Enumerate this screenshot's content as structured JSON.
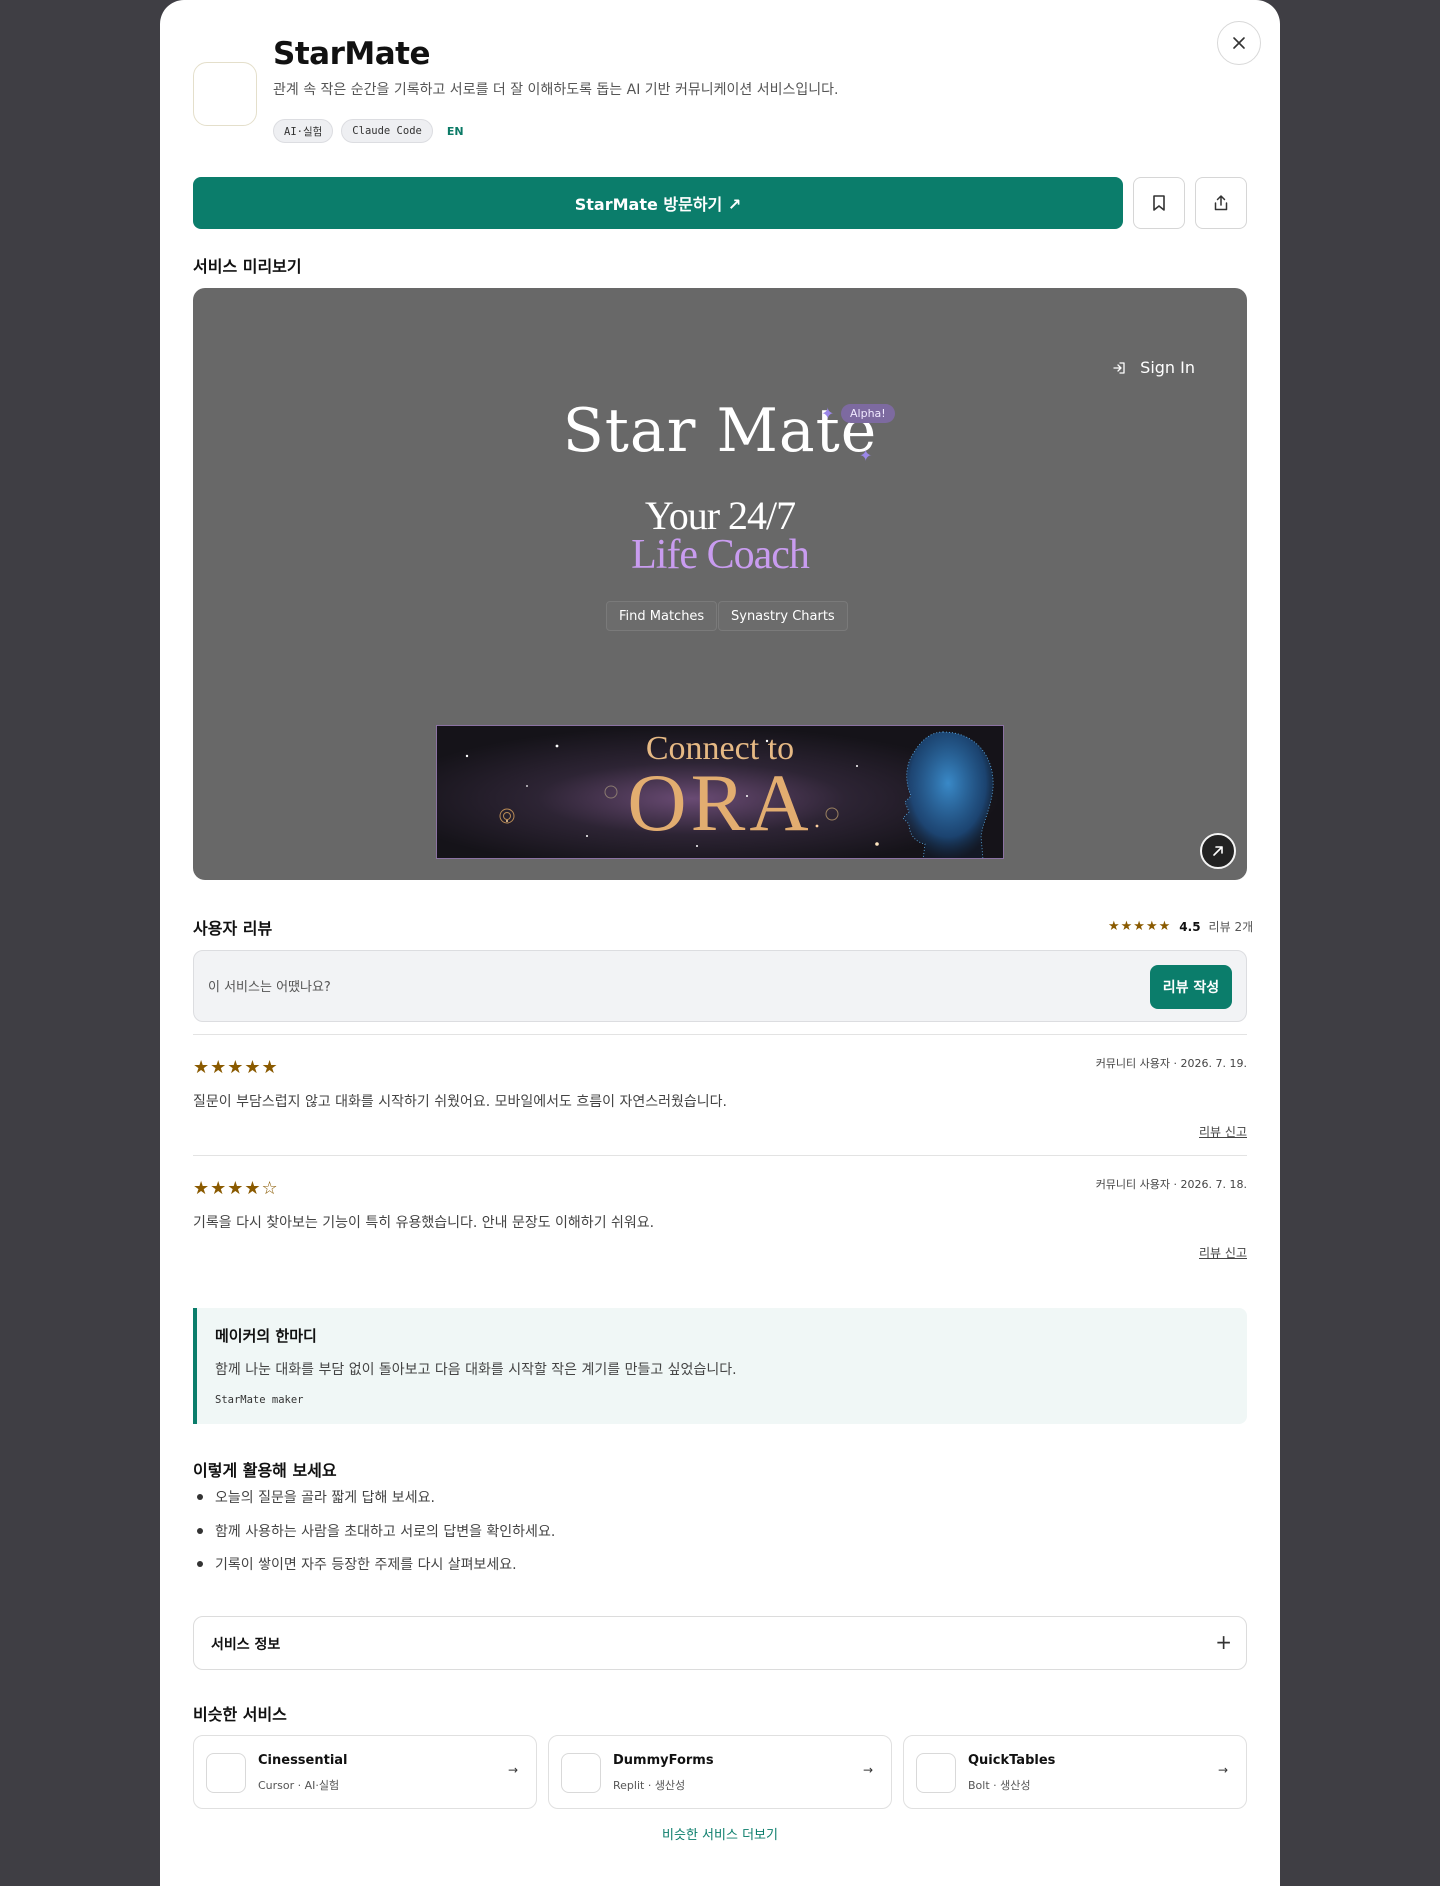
{
  "app": {
    "title": "StarMate",
    "description": "관계 속 작은 순간을 기록하고 서로를 더 잘 이해하도록 돕는 AI 기반 커뮤니케이션 서비스입니다.",
    "tags": [
      "AI·실험",
      "Claude Code"
    ],
    "language": "EN",
    "accent_color": "#0b7d6b"
  },
  "actions": {
    "visit_label": "StarMate 방문하기 ↗",
    "bookmark_icon": "bookmark-icon",
    "share_icon": "share-icon",
    "close_icon": "close-icon"
  },
  "preview": {
    "section_title": "서비스 미리보기",
    "sign_in": "Sign In",
    "brand": "Star Mate",
    "badge": "Alpha!",
    "tagline_line1": "Your 24/7",
    "tagline_line2": "Life Coach",
    "buttons": [
      "Find Matches",
      "Synastry Charts"
    ],
    "banner_line1": "Connect to",
    "banner_line2": "ORA",
    "expand_icon": "arrow-up-right-icon"
  },
  "reviews": {
    "section_title": "사용자 리뷰",
    "summary_stars": "★★★★★",
    "average": "4.5",
    "count_label": "리뷰 2개",
    "input_placeholder": "이 서비스는 어땠나요?",
    "write_button": "리뷰 작성",
    "items": [
      {
        "stars": "★★★★★",
        "meta": "커뮤니티 사용자 · 2026. 7. 19.",
        "text": "질문이 부담스럽지 않고 대화를 시작하기 쉬웠어요. 모바일에서도 흐름이 자연스러웠습니다.",
        "report": "리뷰 신고"
      },
      {
        "stars": "★★★★☆",
        "meta": "커뮤니티 사용자 · 2026. 7. 18.",
        "text": "기록을 다시 찾아보는 기능이 특히 유용했습니다. 안내 문장도 이해하기 쉬워요.",
        "report": "리뷰 신고"
      }
    ]
  },
  "maker": {
    "title": "메이커의 한마디",
    "text": "함께 나눈 대화를 부담 없이 돌아보고 다음 대화를 시작할 작은 계기를 만들고 싶었습니다.",
    "signature": "StarMate maker"
  },
  "usage": {
    "title": "이렇게 활용해 보세요",
    "items": [
      "오늘의 질문을 골라 짧게 답해 보세요.",
      "함께 사용하는 사람을 초대하고 서로의 답변을 확인하세요.",
      "기록이 쌓이면 자주 등장한 주제를 다시 살펴보세요."
    ]
  },
  "info": {
    "title": "서비스 정보",
    "toggle": "+"
  },
  "similar": {
    "title": "비슷한 서비스",
    "items": [
      {
        "name": "Cinessential",
        "sub": "Cursor · AI·실험",
        "arrow": "→"
      },
      {
        "name": "DummyForms",
        "sub": "Replit · 생산성",
        "arrow": "→"
      },
      {
        "name": "QuickTables",
        "sub": "Bolt · 생산성",
        "arrow": "→"
      }
    ],
    "more_label": "비슷한 서비스 더보기"
  }
}
